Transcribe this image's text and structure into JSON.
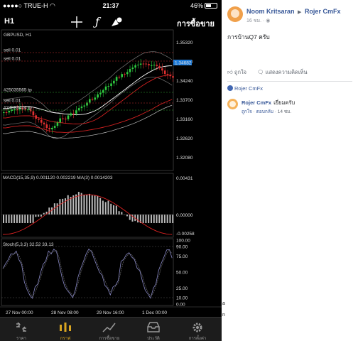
{
  "status": {
    "carrier": "TRUE-H",
    "time": "21:37",
    "battery": "46%",
    "battery_level": 0.46
  },
  "toolbar": {
    "timeframe": "H1",
    "crosshair_icon": "crosshair-icon",
    "function_icon": "function-icon",
    "objects_icon": "objects-icon",
    "trade_label": "การซื้อขาย"
  },
  "chart": {
    "symbol_label": "GBPUSD, H1",
    "order_lines": [
      "sell 0.01",
      "sell 0.01"
    ],
    "price_tag": "1.34682",
    "mid_labels": [
      "#25035565 tp",
      "sell 0.01",
      "#24993414 tp"
    ],
    "price_axis": [
      "1.35320",
      "1.34780",
      "1.34240",
      "1.33700",
      "1.33160",
      "1.32620",
      "1.32080"
    ],
    "macd_label": "MACD(15,35,9) 0.001120 0.002219 MA(3) 0.0014203",
    "macd_axis": [
      "0.00431",
      "0.00000",
      "-0.00258"
    ],
    "stoch_label": "Stoch(5,3,3) 32.52 33.13",
    "stoch_axis": [
      "100.00",
      "90.00",
      "75.00",
      "50.00",
      "25.00",
      "10.00",
      "0.00"
    ],
    "time_axis": [
      "27 Nov 00:00",
      "28 Nov 08:00",
      "29 Nov 16:00",
      "1 Dec 00:00"
    ],
    "colors": {
      "bull": "#2ecc40",
      "bear": "#e03030",
      "ma_red": "#d02020",
      "ma_white": "#ffffff",
      "price_tag_bg": "#1e7bd8"
    }
  },
  "tabs": [
    {
      "label": "ราคา",
      "icon": "quotes-icon",
      "active": false
    },
    {
      "label": "กราฟ",
      "icon": "chart-icon",
      "active": true
    },
    {
      "label": "การซื้อขาย",
      "icon": "trade-icon",
      "active": false
    },
    {
      "label": "ประวัติ",
      "icon": "history-icon",
      "active": false
    },
    {
      "label": "การตั้งค่า",
      "icon": "settings-icon",
      "active": false
    }
  ],
  "post": {
    "author": "Noom Kritsaran",
    "arrow": "▶",
    "group": "Rojer CmFx",
    "time": "16 ชม.",
    "text": "การบ้านQ7 ครับ",
    "like_label": "ถูกใจ",
    "comment_label": "แสดงความคิดเห็น",
    "liked_by": "Rojer CmFx",
    "comment": {
      "name": "Rojer CmFx",
      "text": "เยี่ยมครับ",
      "like": "ถูกใจ",
      "reply": "ตอบกลับ",
      "time": "14 ชม."
    }
  },
  "side_chars": [
    "a",
    "n"
  ]
}
